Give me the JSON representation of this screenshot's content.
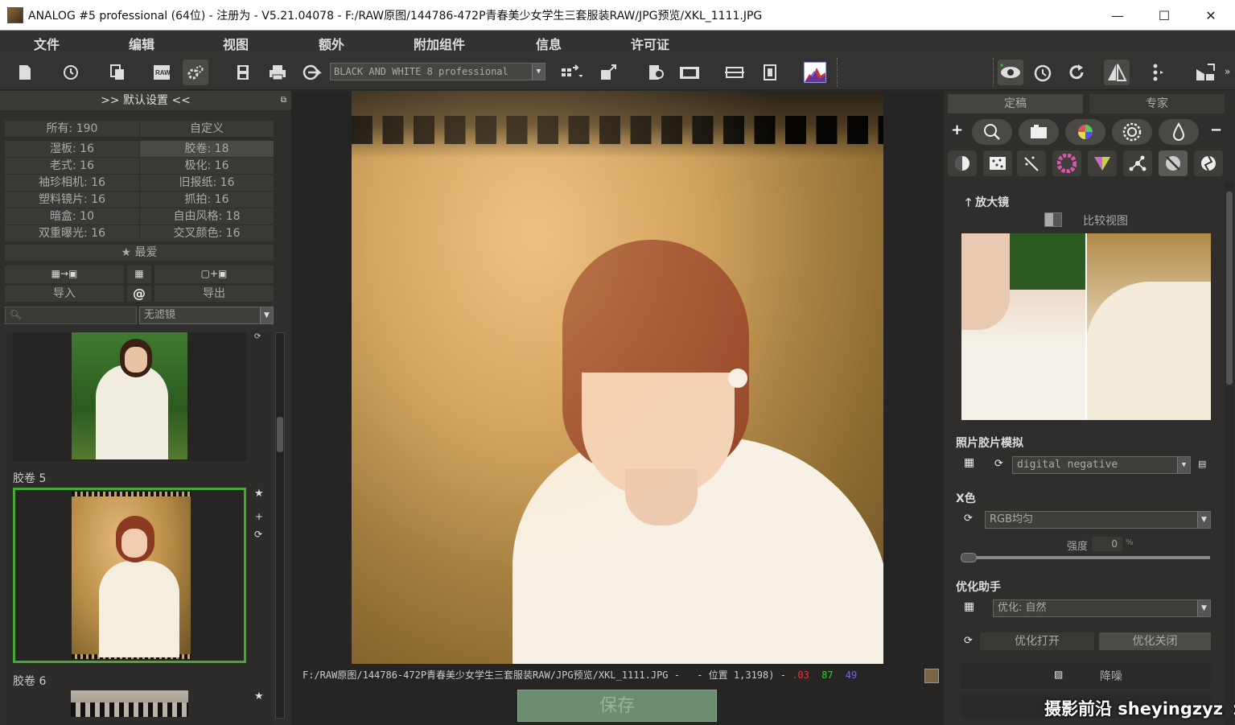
{
  "window": {
    "title": "ANALOG #5 professional (64位) - 注册为 - V5.21.04078 - F:/RAW原图/144786-472P青春美少女学生三套服装RAW/JPG预览/XKL_1111.JPG",
    "minimize": "—",
    "maximize": "☐",
    "close": "✕"
  },
  "menu": {
    "items": [
      "文件",
      "编辑",
      "视图",
      "额外",
      "附加组件",
      "信息",
      "许可证"
    ]
  },
  "toolbar": {
    "preset": "BLACK AND WHITE 8 professional"
  },
  "left_panel": {
    "header": ">> 默认设置 <<",
    "categories": [
      {
        "label": "所有: 190"
      },
      {
        "label": "自定义"
      },
      {
        "label": "湿板: 16"
      },
      {
        "label": "胶卷: 18"
      },
      {
        "label": "老式: 16"
      },
      {
        "label": "极化: 16"
      },
      {
        "label": "袖珍相机: 16"
      },
      {
        "label": "旧报纸: 16"
      },
      {
        "label": "塑料镜片: 16"
      },
      {
        "label": "抓拍: 16"
      },
      {
        "label": "暗盒: 10"
      },
      {
        "label": "自由风格: 18"
      },
      {
        "label": "双重曝光: 16"
      },
      {
        "label": "交叉颜色: 16"
      }
    ],
    "favorites": "★ 最爱",
    "import": "导入",
    "at": "@",
    "export": "导出",
    "filter": "无滤镜",
    "groups": [
      {
        "label": "胶卷 5"
      },
      {
        "label": "胶卷 6"
      }
    ]
  },
  "status": {
    "path": "F:/RAW原图/144786-472P青春美少女学生三套服装RAW/JPG预览/XKL_1111.JPG -",
    "coords": "- 位置 1,3198) -",
    "r": ".03",
    "g": "87",
    "b": "49",
    "swatch": "#7a6340"
  },
  "save_label": "保存",
  "right_panel": {
    "tabs": [
      "定稿",
      "专家"
    ],
    "magnifier": "放大镜",
    "compare": "比较视图",
    "film_section": "照片胶片模拟",
    "film_value": "digital negative",
    "color_section": "X色",
    "color_value": "RGB均匀",
    "strength_label": "强度",
    "strength_value": "0",
    "strength_unit": "%",
    "opt_section": "优化助手",
    "opt_value": "优化: 自然",
    "opt_on": "优化打开",
    "opt_off": "优化关闭",
    "noise": "降噪"
  },
  "watermark": "摄影前沿 sheyingzyz.com"
}
